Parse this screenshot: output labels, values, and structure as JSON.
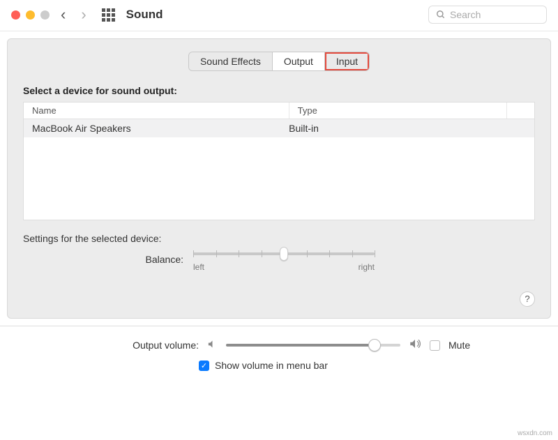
{
  "toolbar": {
    "title": "Sound",
    "search_placeholder": "Search"
  },
  "tabs": {
    "t1": "Sound Effects",
    "t2": "Output",
    "t3": "Input"
  },
  "section": {
    "title": "Select a device for sound output:",
    "col_name": "Name",
    "col_type": "Type"
  },
  "devices": [
    {
      "name": "MacBook Air Speakers",
      "type": "Built-in"
    }
  ],
  "settings": {
    "heading": "Settings for the selected device:",
    "balance": "Balance:",
    "left": "left",
    "right": "right"
  },
  "footer": {
    "volume_label": "Output volume:",
    "mute": "Mute",
    "show_menu": "Show volume in menu bar"
  },
  "attribution": "wsxdn.com"
}
